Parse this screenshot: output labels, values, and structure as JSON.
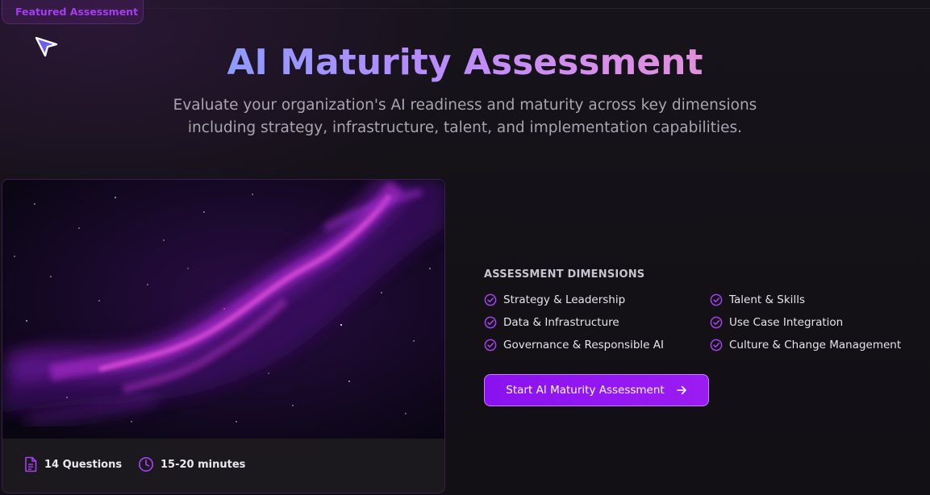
{
  "badge": {
    "label": "Featured Assessment"
  },
  "hero": {
    "title": "AI Maturity Assessment",
    "subtitle": "Evaluate your organization's AI readiness and maturity across key dimensions including strategy, infrastructure, talent, and implementation capabilities."
  },
  "card": {
    "image_icon": "purple-nebula-image",
    "questions": {
      "icon": "document-icon",
      "label": "14 Questions"
    },
    "duration": {
      "icon": "clock-icon",
      "label": "15-20 minutes"
    }
  },
  "dimensions": {
    "heading": "ASSESSMENT DIMENSIONS",
    "check_icon": "check-circle-icon",
    "items": [
      "Strategy & Leadership",
      "Talent & Skills",
      "Data & Infrastructure",
      "Use Case Integration",
      "Governance & Responsible AI",
      "Culture & Change Management"
    ]
  },
  "cta": {
    "label": "Start AI Maturity Assessment",
    "icon": "arrow-right-icon"
  },
  "colors": {
    "accent": "#9b1cf2",
    "badge_text": "#a63cf2",
    "title_gradient_start": "#8d9cff",
    "title_gradient_end": "#e08fd9",
    "background": "#131116"
  }
}
